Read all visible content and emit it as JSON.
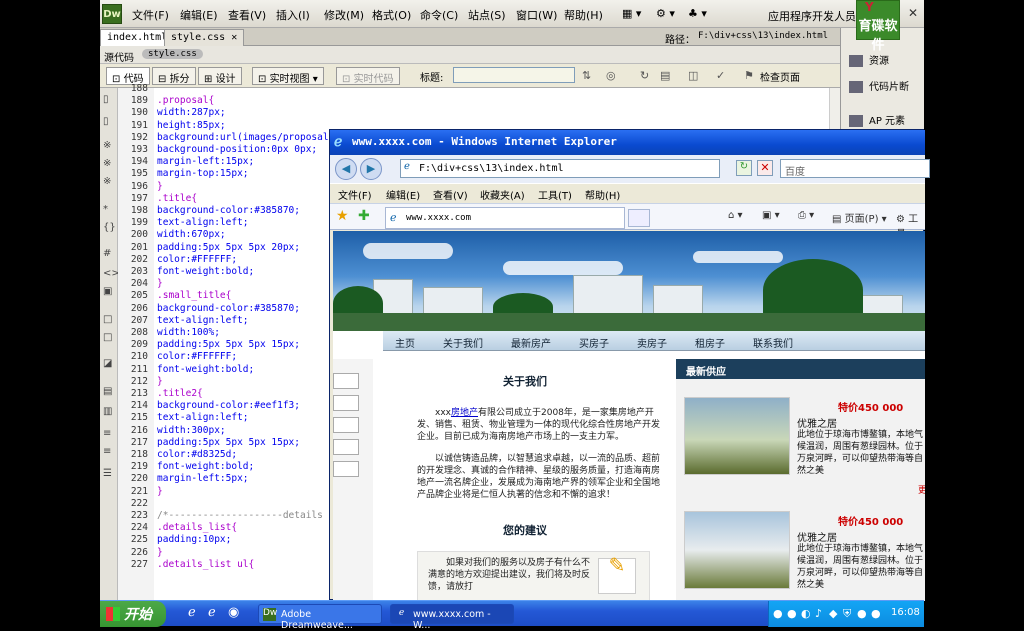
{
  "dw": {
    "logo": "Dw",
    "menu": [
      "文件(F)",
      "编辑(E)",
      "查看(V)",
      "插入(I)",
      "修改(M)",
      "格式(O)",
      "命令(C)",
      "站点(S)",
      "窗口(W)",
      "帮助(H)"
    ],
    "workspace": "应用程序开发人员",
    "brand_top": "Y",
    "brand": "育碟软件",
    "doc_tabs": [
      "index.html",
      "style.css"
    ],
    "path_label": "路径：",
    "path_value": "F:\\div+css\\13\\index.html",
    "related": [
      "源代码",
      "style.css"
    ],
    "buttons": {
      "code": "代码",
      "split": "拆分",
      "design": "设计",
      "live_view": "实时视图",
      "live_code": "实时代码"
    },
    "title_label": "标题:",
    "title_value": "",
    "check_page": "检查页面",
    "panels": [
      "资源",
      "代码片断",
      "AP 元素"
    ],
    "code_lines": [
      {
        "n": "188",
        "t": ""
      },
      {
        "n": "189",
        "t": ".proposal{"
      },
      {
        "n": "190",
        "t": "width:287px;"
      },
      {
        "n": "191",
        "t": "height:85px;"
      },
      {
        "n": "192",
        "t": "background:url(images/proposal"
      },
      {
        "n": "193",
        "t": "background-position:0px 0px;"
      },
      {
        "n": "194",
        "t": "margin-left:15px;"
      },
      {
        "n": "195",
        "t": "margin-top:15px;"
      },
      {
        "n": "196",
        "t": "}"
      },
      {
        "n": "197",
        "t": ".title{"
      },
      {
        "n": "198",
        "t": "background-color:#385870;"
      },
      {
        "n": "199",
        "t": "text-align:left;"
      },
      {
        "n": "200",
        "t": "width:670px;"
      },
      {
        "n": "201",
        "t": "padding:5px 5px 5px 20px;"
      },
      {
        "n": "202",
        "t": "color:#FFFFFF;"
      },
      {
        "n": "203",
        "t": "font-weight:bold;"
      },
      {
        "n": "204",
        "t": "}"
      },
      {
        "n": "205",
        "t": ".small_title{"
      },
      {
        "n": "206",
        "t": "background-color:#385870;"
      },
      {
        "n": "207",
        "t": "text-align:left;"
      },
      {
        "n": "208",
        "t": "width:100%;"
      },
      {
        "n": "209",
        "t": "padding:5px 5px 5px 15px;"
      },
      {
        "n": "210",
        "t": "color:#FFFFFF;"
      },
      {
        "n": "211",
        "t": "font-weight:bold;"
      },
      {
        "n": "212",
        "t": "}"
      },
      {
        "n": "213",
        "t": ".title2{"
      },
      {
        "n": "214",
        "t": "background-color:#eef1f3;"
      },
      {
        "n": "215",
        "t": "text-align:left;"
      },
      {
        "n": "216",
        "t": "width:300px;"
      },
      {
        "n": "217",
        "t": "padding:5px 5px 5px 15px;"
      },
      {
        "n": "218",
        "t": "color:#d8325d;"
      },
      {
        "n": "219",
        "t": "font-weight:bold;"
      },
      {
        "n": "220",
        "t": "margin-left:5px;"
      },
      {
        "n": "221",
        "t": "}"
      },
      {
        "n": "222",
        "t": ""
      },
      {
        "n": "223",
        "t": "/*--------------------details l"
      },
      {
        "n": "224",
        "t": ".details_list{"
      },
      {
        "n": "225",
        "t": "padding:10px;"
      },
      {
        "n": "226",
        "t": "}"
      },
      {
        "n": "227",
        "t": ".details_list ul{"
      }
    ]
  },
  "ie": {
    "title": "www.xxxx.com - Windows Internet Explorer",
    "address": "F:\\div+css\\13\\index.html",
    "search_placeholder": "百度",
    "menu": [
      "文件(F)",
      "编辑(E)",
      "查看(V)",
      "收藏夹(A)",
      "工具(T)",
      "帮助(H)"
    ],
    "tab_title": "www.xxxx.com",
    "page_menu": "页面(P)",
    "tools_menu": "工具",
    "nav": [
      "主页",
      "关于我们",
      "最新房产",
      "买房子",
      "卖房子",
      "租房子",
      "联系我们"
    ],
    "about_title": "关于我们",
    "about_p1_pre": "xxx",
    "about_link": "房地产",
    "about_p1_post": "有限公司成立于2008年，是一家集房地产开发、销售、租赁、物业管理为一体的现代化综合性房地产开发企业。目前已成为海南房地产市场上的一支主力军。",
    "about_p2": "以诚信铸造品牌，以智慧追求卓越，以一流的品质、超前的开发理念、真诚的合作精神、星级的服务质量，打造海南房地产一流名牌企业，发展成为海南地产界的领军企业和全国地产品牌企业将是仁恒人执著的信念和不懈的追求！",
    "suggest_title": "您的建议",
    "suggest_text": "如果对我们的服务以及房子有什么不满意的地方欢迎提出建议，我们将及时反馈，请放打",
    "latest_title": "最新供应",
    "houses": [
      {
        "price": "特价450 000",
        "name": "优雅之居",
        "desc": "此地位于琼海市博鳌镇，本地气候温润，周围有葱绿园林。位于万泉河畔，可以仰望热带海等自然之美"
      },
      {
        "price": "特价450 000",
        "name": "优雅之居",
        "desc": "此地位于琼海市博鳌镇，本地气候温润，周围有葱绿园林。位于万泉河畔，可以仰望热带海等自然之美"
      }
    ],
    "more": "更"
  },
  "taskbar": {
    "start": "开始",
    "items": [
      "Adobe Dreamweave...",
      "www.xxxx.com - W..."
    ],
    "time": "16:08"
  },
  "colors": {
    "accent": "#385870",
    "price": "#c00000",
    "ie_title": "#0a4ad0",
    "taskbar": "#2458d6"
  }
}
